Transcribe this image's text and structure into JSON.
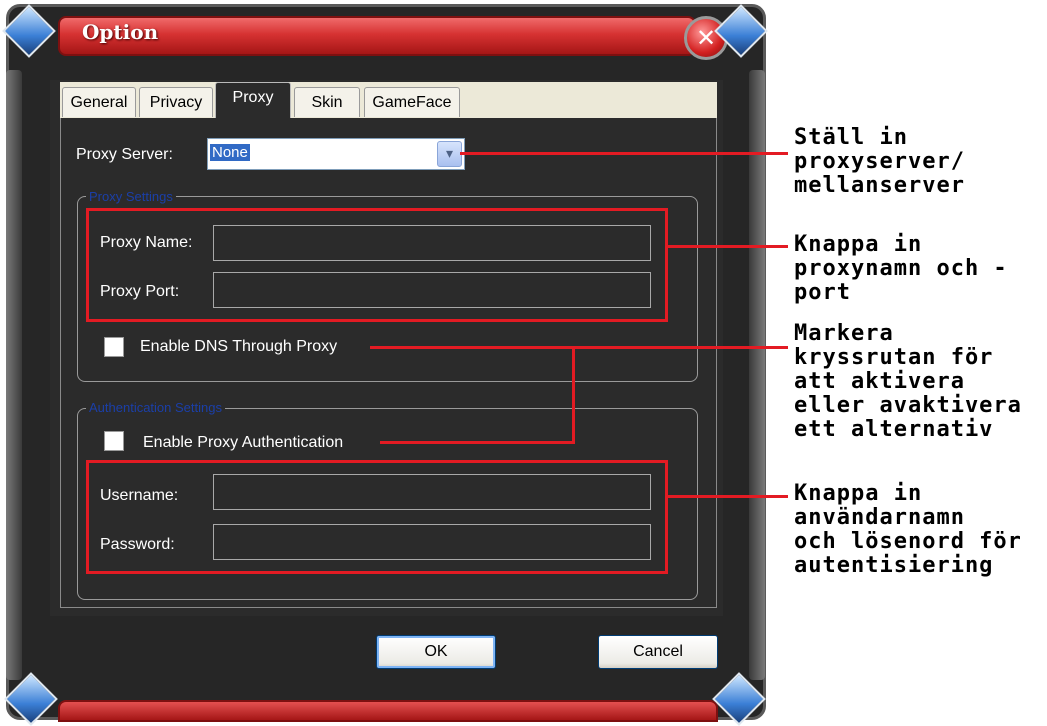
{
  "window": {
    "title": "Option",
    "close_glyph": "✕"
  },
  "tabs": [
    {
      "label": "General",
      "active": false
    },
    {
      "label": "Privacy",
      "active": false
    },
    {
      "label": "Proxy",
      "active": true
    },
    {
      "label": "Skin",
      "active": false
    },
    {
      "label": "GameFace",
      "active": false
    }
  ],
  "proxy_server": {
    "label": "Proxy Server:",
    "value": "None",
    "arrow_glyph": "▾"
  },
  "proxy_settings": {
    "legend": "Proxy Settings",
    "name_label": "Proxy Name:",
    "name_value": "",
    "port_label": "Proxy Port:",
    "port_value": "",
    "dns_checkbox_label": "Enable DNS Through Proxy",
    "dns_checked": false
  },
  "auth_settings": {
    "legend": "Authentication Settings",
    "auth_checkbox_label": "Enable Proxy Authentication",
    "auth_checked": false,
    "username_label": "Username:",
    "username_value": "",
    "password_label": "Password:",
    "password_value": ""
  },
  "buttons": {
    "ok": "OK",
    "cancel": "Cancel"
  },
  "callouts": [
    "Ställ in\nproxyserver/\nmellanserver",
    "Knappa in\nproxynamn och -\nport",
    "Markera\nkryssrutan för\natt aktivera\neller avaktivera\nett alternativ",
    "Knappa in\nanvändarnamn\noch lösenord för\nautentisiering"
  ],
  "colors": {
    "accent_red": "#e31b23",
    "title_red": "#d63232",
    "panel_bg": "#2b2b2b",
    "legend_blue": "#1b3fa8",
    "selection_blue": "#316ac5"
  },
  "icons": [
    "close-icon",
    "dropdown-arrow-icon",
    "corner-gem-icon"
  ]
}
